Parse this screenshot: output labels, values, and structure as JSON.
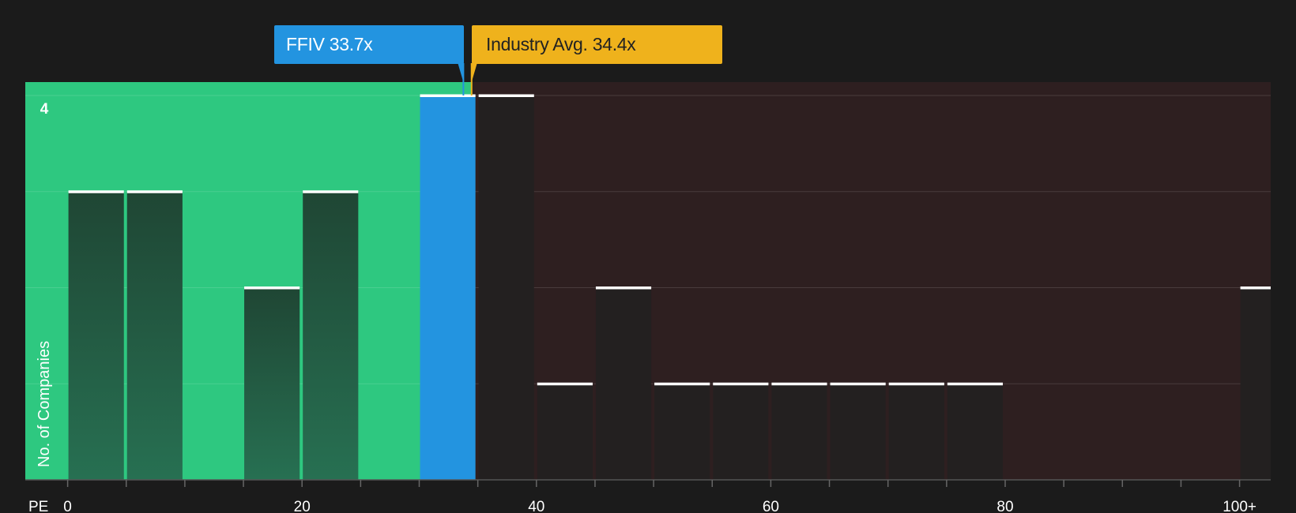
{
  "chart_data": {
    "type": "bar",
    "xlabel": "PE",
    "ylabel": "No. of Companies",
    "bin_width": 5,
    "x_range": [
      0,
      100
    ],
    "ylim": [
      0,
      4
    ],
    "x_ticks": [
      {
        "value": 0,
        "label": "0"
      },
      {
        "value": 20,
        "label": "20"
      },
      {
        "value": 40,
        "label": "40"
      },
      {
        "value": 60,
        "label": "60"
      },
      {
        "value": 80,
        "label": "80"
      },
      {
        "value": 100,
        "label": "100+"
      }
    ],
    "y_tick_label": "4",
    "bins": [
      {
        "start": 0,
        "count": 3
      },
      {
        "start": 5,
        "count": 3
      },
      {
        "start": 10,
        "count": 0
      },
      {
        "start": 15,
        "count": 2
      },
      {
        "start": 20,
        "count": 3
      },
      {
        "start": 25,
        "count": 0
      },
      {
        "start": 30,
        "count": 4
      },
      {
        "start": 35,
        "count": 4
      },
      {
        "start": 40,
        "count": 1
      },
      {
        "start": 45,
        "count": 2
      },
      {
        "start": 50,
        "count": 1
      },
      {
        "start": 55,
        "count": 1
      },
      {
        "start": 60,
        "count": 1
      },
      {
        "start": 65,
        "count": 1
      },
      {
        "start": 70,
        "count": 1
      },
      {
        "start": 75,
        "count": 1
      },
      {
        "start": 80,
        "count": 0
      },
      {
        "start": 85,
        "count": 0
      },
      {
        "start": 90,
        "count": 0
      },
      {
        "start": 95,
        "count": 0
      },
      {
        "start": 100,
        "count": 2
      }
    ],
    "company": {
      "ticker": "FFIV",
      "value": 33.7,
      "label": "FFIV 33.7x",
      "color": "#2394e0"
    },
    "industry": {
      "value": 34.4,
      "label": "Industry Avg. 34.4x",
      "color": "#efb21c"
    },
    "colors": {
      "background": "#1b1b1b",
      "good_region": "#2ec880",
      "bad_region": "#2e1f20",
      "bar_good": "#23503a",
      "bar_bad": "#232020"
    }
  }
}
